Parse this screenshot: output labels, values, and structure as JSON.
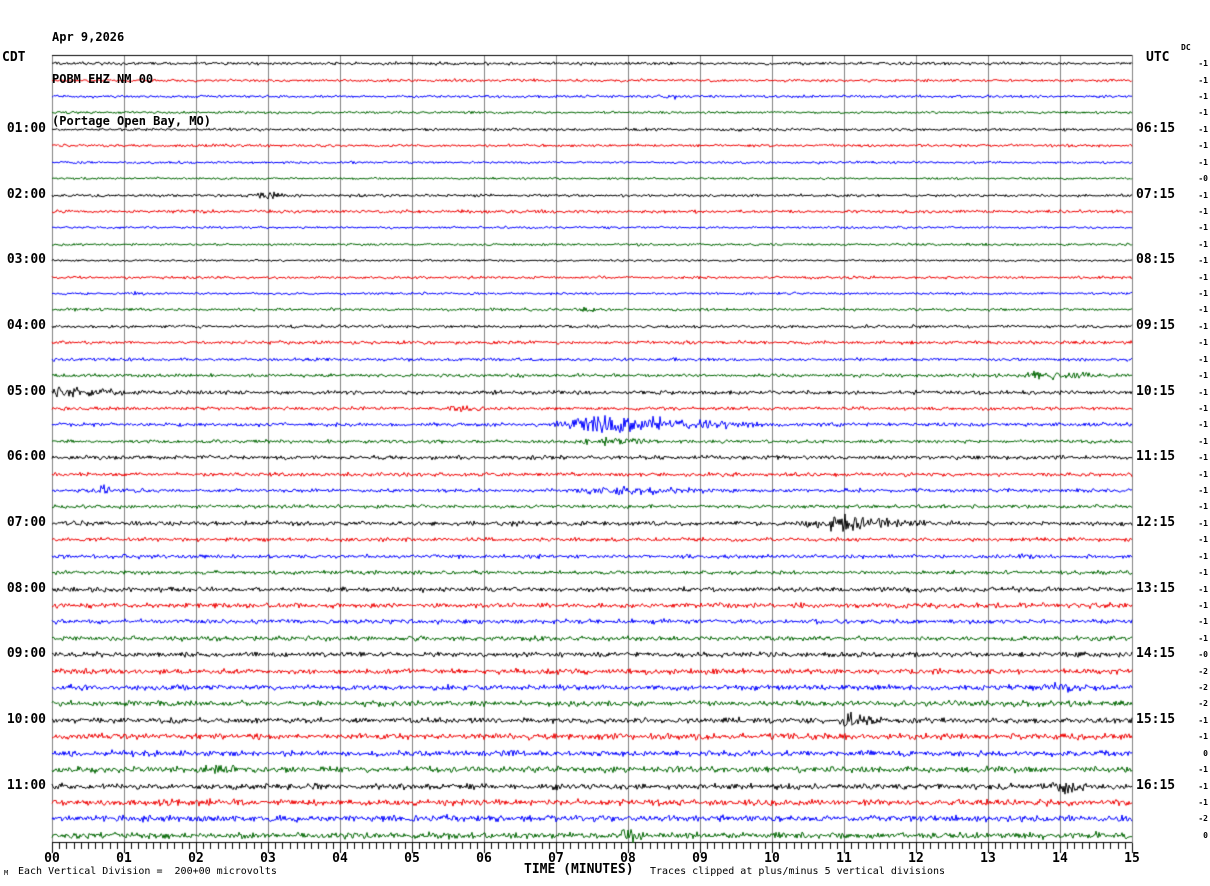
{
  "header": {
    "date": "Apr 9,2026",
    "station": "POBM EHZ NM 00",
    "location": "(Portage Open Bay, MO)"
  },
  "left_axis": {
    "title": "CDT"
  },
  "right_axis": {
    "title": "UTC",
    "dc_header": "DC"
  },
  "x_axis": {
    "title": "TIME (MINUTES)",
    "tick_labels": [
      "00",
      "01",
      "02",
      "03",
      "04",
      "05",
      "06",
      "07",
      "08",
      "09",
      "10",
      "11",
      "12",
      "13",
      "14",
      "15"
    ]
  },
  "footer": {
    "watermark": "M",
    "scale_note": "Each Vertical Division =  200+00 microvolts",
    "clip_note": "Traces clipped at plus/minus 5 vertical divisions"
  },
  "chart_data": {
    "type": "line",
    "subtype": "helicorder-seismogram",
    "minutes_per_row": 15,
    "x_range": [
      0,
      15
    ],
    "minor_ticks_per_minute": 10,
    "clip_divisions": 5,
    "grid_color": "#808080",
    "trace_colors": [
      "#000000",
      "#ee0000",
      "#0000ff",
      "#006600"
    ],
    "rows": [
      {
        "cdt": null,
        "utc": null,
        "dc": "-1",
        "color": 0,
        "amp": 1.0,
        "events": []
      },
      {
        "cdt": null,
        "utc": null,
        "dc": "-1",
        "color": 1,
        "amp": 0.9,
        "events": []
      },
      {
        "cdt": null,
        "utc": null,
        "dc": "-1",
        "color": 2,
        "amp": 0.9,
        "events": [
          [
            8.4,
            9.1,
            0.9
          ]
        ]
      },
      {
        "cdt": null,
        "utc": null,
        "dc": "-1",
        "color": 3,
        "amp": 0.8,
        "events": []
      },
      {
        "cdt": "01:00",
        "utc": "06:15",
        "dc": "-1",
        "color": 0,
        "amp": 0.9,
        "events": []
      },
      {
        "cdt": null,
        "utc": null,
        "dc": "-1",
        "color": 1,
        "amp": 0.9,
        "events": []
      },
      {
        "cdt": null,
        "utc": null,
        "dc": "-1",
        "color": 2,
        "amp": 0.8,
        "events": []
      },
      {
        "cdt": null,
        "utc": null,
        "dc": "-0",
        "color": 3,
        "amp": 0.7,
        "events": []
      },
      {
        "cdt": "02:00",
        "utc": "07:15",
        "dc": "-1",
        "color": 0,
        "amp": 0.9,
        "events": [
          [
            2.7,
            3.5,
            1.6
          ]
        ]
      },
      {
        "cdt": null,
        "utc": null,
        "dc": "-1",
        "color": 1,
        "amp": 1.0,
        "events": []
      },
      {
        "cdt": null,
        "utc": null,
        "dc": "-1",
        "color": 2,
        "amp": 0.8,
        "events": []
      },
      {
        "cdt": null,
        "utc": null,
        "dc": "-1",
        "color": 3,
        "amp": 0.8,
        "events": []
      },
      {
        "cdt": "03:00",
        "utc": "08:15",
        "dc": "-1",
        "color": 0,
        "amp": 0.7,
        "events": []
      },
      {
        "cdt": null,
        "utc": null,
        "dc": "-1",
        "color": 1,
        "amp": 0.9,
        "events": []
      },
      {
        "cdt": null,
        "utc": null,
        "dc": "-1",
        "color": 2,
        "amp": 0.8,
        "events": [
          [
            1.0,
            1.3,
            1.2
          ]
        ]
      },
      {
        "cdt": null,
        "utc": null,
        "dc": "-1",
        "color": 3,
        "amp": 0.9,
        "events": [
          [
            7.2,
            7.7,
            1.3
          ]
        ]
      },
      {
        "cdt": "04:00",
        "utc": "09:15",
        "dc": "-1",
        "color": 0,
        "amp": 1.0,
        "events": []
      },
      {
        "cdt": null,
        "utc": null,
        "dc": "-1",
        "color": 1,
        "amp": 1.1,
        "events": []
      },
      {
        "cdt": null,
        "utc": null,
        "dc": "-1",
        "color": 2,
        "amp": 1.0,
        "events": []
      },
      {
        "cdt": null,
        "utc": null,
        "dc": "-1",
        "color": 3,
        "amp": 1.1,
        "events": [
          [
            13.4,
            15.0,
            1.8,
            0.25
          ]
        ]
      },
      {
        "cdt": "05:00",
        "utc": "10:15",
        "dc": "-1",
        "color": 0,
        "amp": 1.3,
        "events": [
          [
            0.0,
            1.6,
            2.2,
            0.05
          ]
        ]
      },
      {
        "cdt": null,
        "utc": null,
        "dc": "-1",
        "color": 1,
        "amp": 1.1,
        "events": [
          [
            5.4,
            6.1,
            1.5
          ]
        ]
      },
      {
        "cdt": null,
        "utc": null,
        "dc": "-1",
        "color": 2,
        "amp": 1.2,
        "events": [
          [
            6.9,
            10.4,
            5.0,
            0.18
          ]
        ]
      },
      {
        "cdt": null,
        "utc": null,
        "dc": "-1",
        "color": 3,
        "amp": 1.1,
        "events": [
          [
            7.2,
            8.7,
            1.6
          ]
        ]
      },
      {
        "cdt": "06:00",
        "utc": "11:15",
        "dc": "-1",
        "color": 0,
        "amp": 1.3,
        "events": []
      },
      {
        "cdt": null,
        "utc": null,
        "dc": "-1",
        "color": 1,
        "amp": 1.2,
        "events": []
      },
      {
        "cdt": null,
        "utc": null,
        "dc": "-1",
        "color": 2,
        "amp": 1.2,
        "events": [
          [
            0.55,
            0.95,
            2.2
          ],
          [
            7.2,
            9.6,
            2.0
          ]
        ]
      },
      {
        "cdt": null,
        "utc": null,
        "dc": "-1",
        "color": 3,
        "amp": 1.2,
        "events": []
      },
      {
        "cdt": "07:00",
        "utc": "12:15",
        "dc": "-1",
        "color": 0,
        "amp": 1.4,
        "events": [
          [
            10.4,
            12.4,
            4.0,
            0.3
          ]
        ]
      },
      {
        "cdt": null,
        "utc": null,
        "dc": "-1",
        "color": 1,
        "amp": 1.2,
        "events": []
      },
      {
        "cdt": null,
        "utc": null,
        "dc": "-1",
        "color": 2,
        "amp": 1.2,
        "events": [
          [
            13.3,
            13.7,
            2.2
          ]
        ]
      },
      {
        "cdt": null,
        "utc": null,
        "dc": "-1",
        "color": 3,
        "amp": 1.2,
        "events": []
      },
      {
        "cdt": "08:00",
        "utc": "13:15",
        "dc": "-1",
        "color": 0,
        "amp": 1.5,
        "events": []
      },
      {
        "cdt": null,
        "utc": null,
        "dc": "-1",
        "color": 1,
        "amp": 1.6,
        "events": []
      },
      {
        "cdt": null,
        "utc": null,
        "dc": "-1",
        "color": 2,
        "amp": 1.4,
        "events": []
      },
      {
        "cdt": null,
        "utc": null,
        "dc": "-1",
        "color": 3,
        "amp": 1.5,
        "events": []
      },
      {
        "cdt": "09:00",
        "utc": "14:15",
        "dc": "-0",
        "color": 0,
        "amp": 1.6,
        "events": []
      },
      {
        "cdt": null,
        "utc": null,
        "dc": "-2",
        "color": 1,
        "amp": 1.7,
        "events": []
      },
      {
        "cdt": null,
        "utc": null,
        "dc": "-2",
        "color": 2,
        "amp": 1.7,
        "events": [
          [
            13.4,
            14.6,
            2.0
          ]
        ]
      },
      {
        "cdt": null,
        "utc": null,
        "dc": "-2",
        "color": 3,
        "amp": 1.7,
        "events": []
      },
      {
        "cdt": "10:00",
        "utc": "15:15",
        "dc": "-1",
        "color": 0,
        "amp": 1.7,
        "events": [
          [
            10.9,
            11.7,
            3.5,
            0.2
          ]
        ]
      },
      {
        "cdt": null,
        "utc": null,
        "dc": "-1",
        "color": 1,
        "amp": 1.9,
        "events": []
      },
      {
        "cdt": null,
        "utc": null,
        "dc": "0",
        "color": 2,
        "amp": 1.8,
        "events": []
      },
      {
        "cdt": null,
        "utc": null,
        "dc": "-1",
        "color": 3,
        "amp": 1.9,
        "events": [
          [
            2.0,
            2.6,
            3.0
          ]
        ]
      },
      {
        "cdt": "11:00",
        "utc": "16:15",
        "dc": "-1",
        "color": 0,
        "amp": 1.8,
        "events": [
          [
            13.7,
            14.6,
            3.5
          ]
        ]
      },
      {
        "cdt": null,
        "utc": null,
        "dc": "-1",
        "color": 1,
        "amp": 2.0,
        "events": []
      },
      {
        "cdt": null,
        "utc": null,
        "dc": "-2",
        "color": 2,
        "amp": 2.0,
        "events": []
      },
      {
        "cdt": null,
        "utc": null,
        "dc": "0",
        "color": 3,
        "amp": 2.0,
        "events": [
          [
            7.9,
            8.2,
            7.0,
            0.3
          ]
        ]
      }
    ]
  }
}
